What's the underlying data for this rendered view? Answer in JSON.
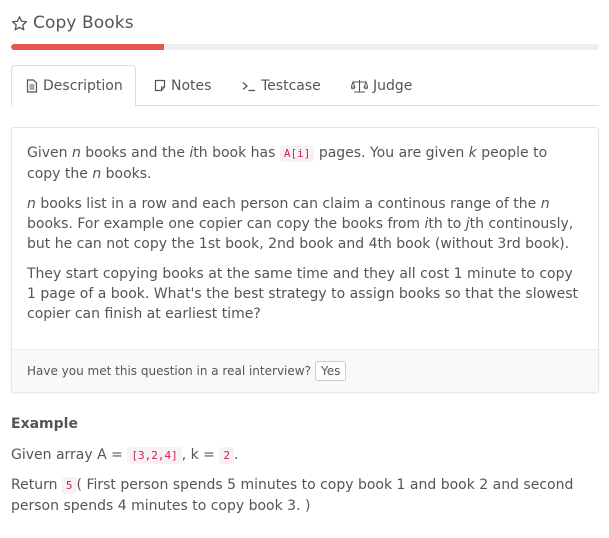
{
  "problem": {
    "title": "Copy Books",
    "progress": 0.26
  },
  "tabs": {
    "description": "Description",
    "notes": "Notes",
    "testcase": "Testcase",
    "judge": "Judge",
    "active": "description"
  },
  "description": {
    "p1": {
      "t1": "Given ",
      "n": "n",
      "t2": " books and the ",
      "i": "i",
      "t3": "th book has ",
      "code": "A[i]",
      "t4": " pages. You are given ",
      "k": "k",
      "t5": " people to copy the ",
      "n2": "n",
      "t6": " books."
    },
    "p2": {
      "n": "n",
      "t1": " books list in a row and each person can claim a continous range of the ",
      "n2": "n",
      "t2": " books. For example one copier can copy the books from ",
      "i": "i",
      "t3": "th to ",
      "j": "j",
      "t4": "th continously, but he can not copy the 1st book, 2nd book and 4th book (without 3rd book)."
    },
    "p3": "They start copying books at the same time and they all cost 1 minute to copy 1 page of a book. What's the best strategy to assign books so that the slowest copier can finish at earliest time?"
  },
  "interview": {
    "question": "Have you met this question in a real interview?",
    "yes_label": "Yes"
  },
  "example": {
    "heading": "Example",
    "line1": {
      "t1": "Given array A = ",
      "code1": "[3,2,4]",
      "t2": ", k = ",
      "code2": "2",
      "t3": "."
    },
    "line2": {
      "t1": "Return ",
      "code": "5",
      "t2": "( First person spends 5 minutes to copy book 1 and book 2 and second person spends 4 minutes to copy book 3. )"
    }
  }
}
